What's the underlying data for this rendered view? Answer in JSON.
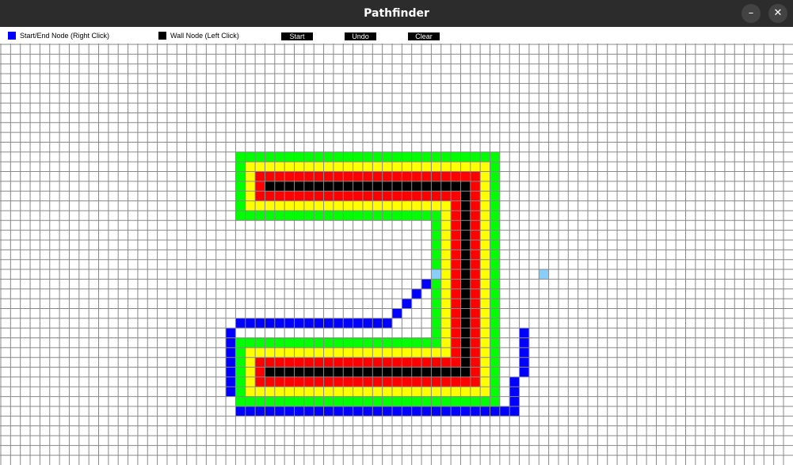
{
  "window": {
    "title": "Pathfinder",
    "minimize_glyph": "–",
    "close_glyph": "✕"
  },
  "toolbar": {
    "legend": [
      {
        "label": "Start/End Node (Right Click)",
        "color": "#0000ff"
      },
      {
        "label": "Wall Node (Left Click)",
        "color": "#000000"
      }
    ],
    "buttons": {
      "start": "Start",
      "undo": "Undo",
      "clear": "Clear"
    }
  },
  "colors": {
    "background": "#ffffff",
    "grid_line": "#888888",
    "wall": "#000000",
    "ring_red": "#ff0000",
    "ring_yellow": "#ffff00",
    "ring_green": "#00ff00",
    "path": "#0000ff",
    "endpoint": "#87cefa"
  },
  "grid": {
    "columns": 81,
    "rows": 43,
    "cells": {
      "wall": [
        "c27-47:r14",
        "c47:r15-33",
        "c27-46:r33"
      ],
      "red": [
        "c26-48:r13",
        "c26:r14",
        "c26-46:r15",
        "c46:r16-32",
        "c48:r14-34",
        "c26-45:r32",
        "c26:r33",
        "c26-47:r34"
      ],
      "yellow": [
        "c25-49:r12",
        "c25:r13-15",
        "c25-45:r16",
        "c45:r17-31",
        "c49:r13-35",
        "c25-44:r31",
        "c25:r32-34",
        "c25-48:r35"
      ],
      "green": [
        "c24-50:r11",
        "c24:r12-16",
        "c24-44:r17",
        "c44:r18-30",
        "c50:r12-36",
        "c24-43:r30",
        "c24:r31-35",
        "c24-49:r36"
      ],
      "path": [
        "c43:r24",
        "c42:r25",
        "c41:r26",
        "c40:r27",
        "c24-39:r28",
        "c23:r29-35",
        "c24-52:r37",
        "c53:r29-33",
        "c52:r34-36"
      ],
      "endpoint": [
        "c44:r23",
        "c55:r23"
      ]
    }
  }
}
